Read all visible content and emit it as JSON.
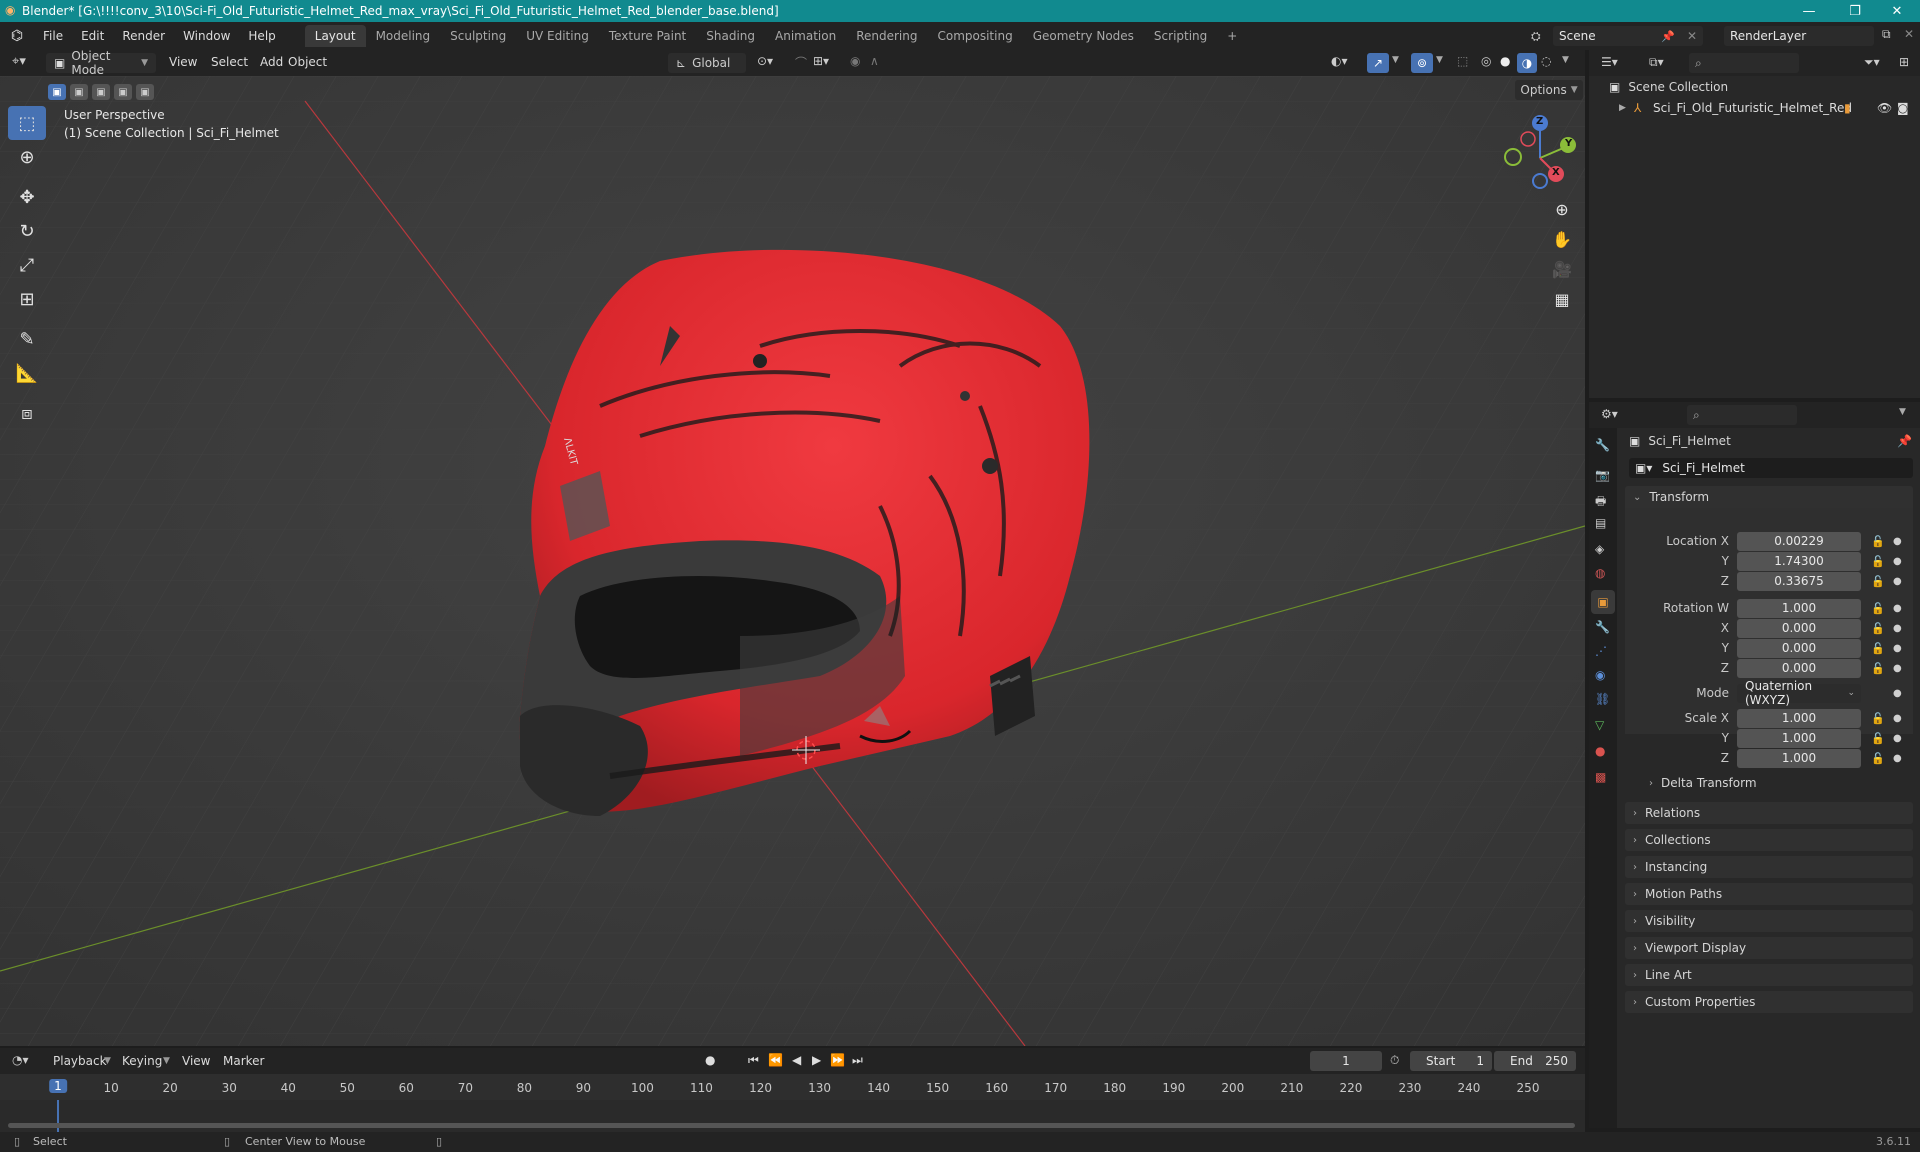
{
  "window": {
    "title": "Blender* [G:\\!!!!conv_3\\10\\Sci-Fi_Old_Futuristic_Helmet_Red_max_vray\\Sci_Fi_Old_Futuristic_Helmet_Red_blender_base.blend]",
    "minimize": "—",
    "restore": "❐",
    "close": "✕"
  },
  "menu": [
    "File",
    "Edit",
    "Render",
    "Window",
    "Help"
  ],
  "workspaces": [
    "Layout",
    "Modeling",
    "Sculpting",
    "UV Editing",
    "Texture Paint",
    "Shading",
    "Animation",
    "Rendering",
    "Compositing",
    "Geometry Nodes",
    "Scripting"
  ],
  "workspace_add": "+",
  "scene": {
    "label": "Scene",
    "render_layer": "RenderLayer"
  },
  "viewport_header": {
    "mode": "Object Mode",
    "view": "View",
    "select": "Select",
    "add": "Add",
    "object": "Object",
    "orientation": "Global",
    "options": "Options"
  },
  "viewport": {
    "perspective": "User Perspective",
    "collection_line": "(1) Scene Collection | Sci_Fi_Helmet",
    "gizmo": {
      "z": "Z",
      "y": "Y",
      "x": "X"
    },
    "helmet_decal": "ΛLKIT"
  },
  "outliner": {
    "root": "Scene Collection",
    "items": [
      {
        "label": "Sci_Fi_Old_Futuristic_Helmet_Red"
      }
    ]
  },
  "properties": {
    "object_name": "Sci_Fi_Helmet",
    "object_field": "Sci_Fi_Helmet",
    "transform_label": "Transform",
    "location": {
      "label_x": "Location X",
      "label_y": "Y",
      "label_z": "Z",
      "x": "0.00229",
      "y": "1.74300",
      "z": "0.33675"
    },
    "rotation": {
      "label_w": "Rotation W",
      "label_x": "X",
      "label_y": "Y",
      "label_z": "Z",
      "w": "1.000",
      "x": "0.000",
      "y": "0.000",
      "z": "0.000"
    },
    "mode": {
      "label": "Mode",
      "value": "Quaternion (WXYZ)"
    },
    "scale": {
      "label_x": "Scale X",
      "label_y": "Y",
      "label_z": "Z",
      "x": "1.000",
      "y": "1.000",
      "z": "1.000"
    },
    "delta": "Delta Transform",
    "panels": [
      "Relations",
      "Collections",
      "Instancing",
      "Motion Paths",
      "Visibility",
      "Viewport Display",
      "Line Art",
      "Custom Properties"
    ]
  },
  "timeline": {
    "playback": "Playback",
    "keying": "Keying",
    "view": "View",
    "marker": "Marker",
    "current_frame": "1",
    "start_label": "Start",
    "start": "1",
    "end_label": "End",
    "end": "250",
    "ticks": [
      "1",
      "10",
      "20",
      "30",
      "40",
      "50",
      "60",
      "70",
      "80",
      "90",
      "100",
      "110",
      "120",
      "130",
      "140",
      "150",
      "160",
      "170",
      "180",
      "190",
      "200",
      "210",
      "220",
      "230",
      "240",
      "250"
    ]
  },
  "status": {
    "select": "Select",
    "center": "Center View to Mouse",
    "version": "3.6.11"
  }
}
